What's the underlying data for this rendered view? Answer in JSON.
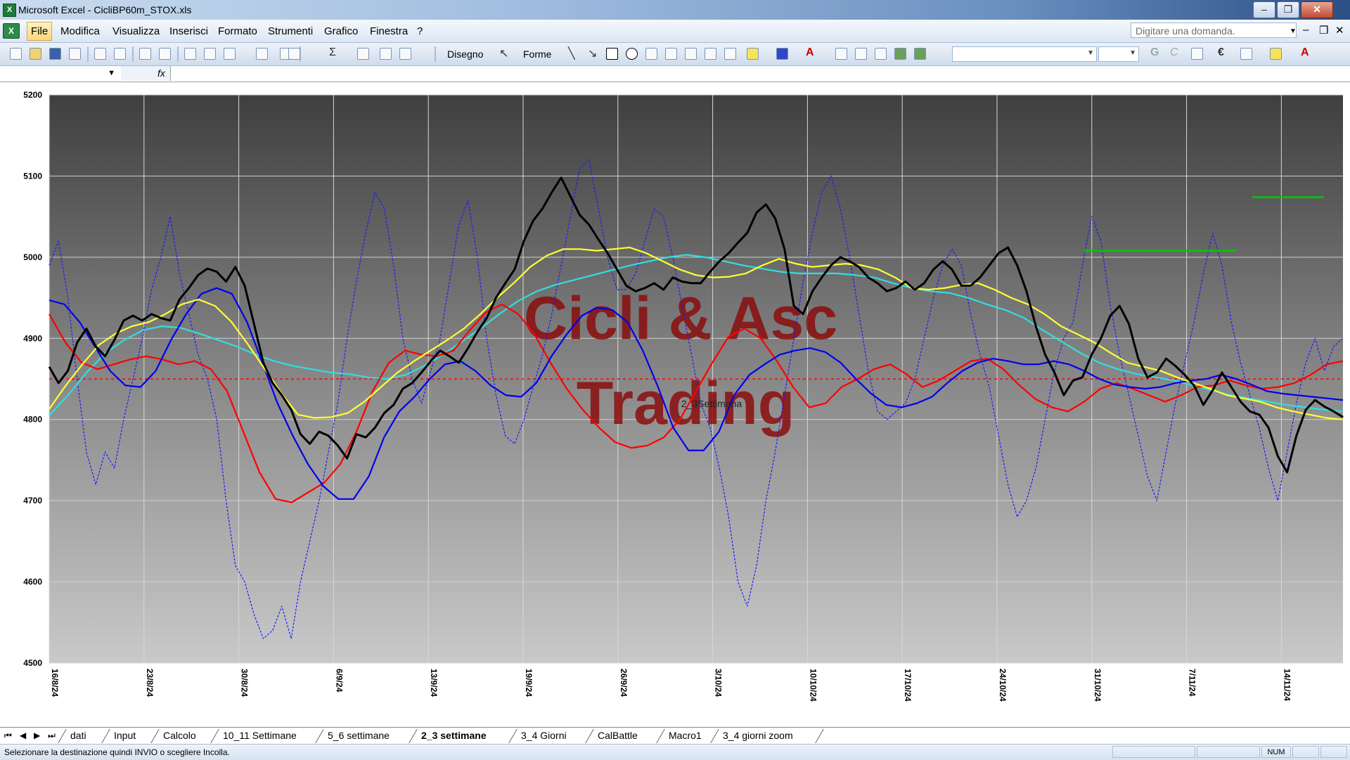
{
  "window": {
    "title": "Microsoft Excel - CicliBP60m_STOX.xls",
    "app_icon": "excel-icon"
  },
  "menu": {
    "items": [
      "File",
      "Modifica",
      "Visualizza",
      "Inserisci",
      "Formato",
      "Strumenti",
      "Grafico",
      "Finestra",
      "?"
    ],
    "active": "File",
    "help_placeholder": "Digitare una domanda."
  },
  "toolbar": {
    "draw_label": "Disegno",
    "shapes_label": "Forme"
  },
  "sheets": {
    "tabs": [
      "dati",
      "Input",
      "Calcolo",
      "10_11 Settimane",
      "5_6 settimane",
      "2_3 settimane",
      "3_4 Giorni",
      "CalBattle",
      "Macro1",
      "3_4 giorni zoom"
    ],
    "active": "2_3 settimane"
  },
  "status": {
    "message": "Selezionare la destinazione quindi INVIO o scegliere Incolla.",
    "num": "NUM"
  },
  "chart_data": {
    "type": "line",
    "title": "",
    "watermark_line1": "Cicli & Asc",
    "watermark_line2": "Trading",
    "series_label": "2_3Settimana",
    "ylim": [
      4500,
      5200
    ],
    "yticks": [
      "5200",
      "5100",
      "5000",
      "4900",
      "4800",
      "4700",
      "4600",
      "4500"
    ],
    "xticks": [
      "16/8/24",
      "23/8/24",
      "30/8/24",
      "6/9/24",
      "13/9/24",
      "19/9/24",
      "26/9/24",
      "3/10/24",
      "10/10/24",
      "17/10/24",
      "24/10/24",
      "31/10/24",
      "7/11/24",
      "14/11/24"
    ],
    "reference_level": 4850,
    "segments": [
      {
        "color": "#00cc00",
        "x_from": 0.8,
        "x_to": 0.917,
        "y": 5008
      },
      {
        "color": "#00cc00",
        "x_from": 0.93,
        "x_to": 0.985,
        "y": 5074
      }
    ],
    "colors": {
      "price": "#000000",
      "blue": "#0000ee",
      "red": "#ff0000",
      "yellow": "#ffff33",
      "cyan": "#33dddd",
      "osc": "#1a1aff",
      "refline": "#ff0000"
    },
    "series": [
      {
        "key": "price",
        "values": [
          4865,
          4845,
          4860,
          4895,
          4912,
          4890,
          4878,
          4898,
          4922,
          4928,
          4922,
          4930,
          4925,
          4922,
          4948,
          4962,
          4978,
          4986,
          4982,
          4970,
          4988,
          4965,
          4918,
          4870,
          4845,
          4830,
          4812,
          4782,
          4770,
          4785,
          4780,
          4768,
          4752,
          4782,
          4778,
          4790,
          4808,
          4818,
          4838,
          4845,
          4858,
          4872,
          4885,
          4878,
          4870,
          4888,
          4908,
          4925,
          4950,
          4968,
          4985,
          5020,
          5045,
          5060,
          5080,
          5098,
          5075,
          5052,
          5040,
          5022,
          5005,
          4985,
          4965,
          4958,
          4962,
          4968,
          4960,
          4975,
          4970,
          4968,
          4968,
          4982,
          4995,
          5005,
          5018,
          5030,
          5055,
          5065,
          5048,
          5010,
          4940,
          4930,
          4958,
          4975,
          4990,
          5000,
          4995,
          4988,
          4975,
          4968,
          4958,
          4962,
          4970,
          4960,
          4968,
          4985,
          4995,
          4985,
          4965,
          4965,
          4975,
          4990,
          5005,
          5012,
          4990,
          4958,
          4915,
          4880,
          4858,
          4830,
          4848,
          4852,
          4880,
          4900,
          4928,
          4940,
          4918,
          4875,
          4852,
          4858,
          4875,
          4866,
          4855,
          4842,
          4818,
          4836,
          4858,
          4840,
          4822,
          4810,
          4806,
          4790,
          4755,
          4735,
          4780,
          4812,
          4824,
          4816,
          4810,
          4803
        ]
      },
      {
        "key": "blue",
        "values": [
          4947,
          4942,
          4920,
          4890,
          4860,
          4842,
          4840,
          4860,
          4898,
          4930,
          4955,
          4962,
          4955,
          4920,
          4870,
          4820,
          4780,
          4745,
          4718,
          4702,
          4702,
          4730,
          4778,
          4810,
          4828,
          4850,
          4868,
          4872,
          4860,
          4842,
          4830,
          4828,
          4845,
          4878,
          4905,
          4928,
          4938,
          4935,
          4920,
          4885,
          4840,
          4790,
          4762,
          4762,
          4785,
          4830,
          4855,
          4868,
          4880,
          4885,
          4888,
          4883,
          4870,
          4850,
          4832,
          4818,
          4815,
          4820,
          4828,
          4845,
          4860,
          4870,
          4875,
          4872,
          4868,
          4868,
          4872,
          4868,
          4860,
          4850,
          4843,
          4840,
          4838,
          4840,
          4845,
          4848,
          4850,
          4855,
          4850,
          4843,
          4835,
          4832,
          4830,
          4828,
          4826,
          4824
        ]
      },
      {
        "key": "red",
        "values": [
          4930,
          4895,
          4870,
          4862,
          4868,
          4874,
          4878,
          4874,
          4868,
          4872,
          4862,
          4835,
          4785,
          4735,
          4702,
          4698,
          4710,
          4722,
          4745,
          4785,
          4835,
          4870,
          4885,
          4880,
          4878,
          4885,
          4910,
          4932,
          4942,
          4930,
          4905,
          4870,
          4838,
          4812,
          4790,
          4772,
          4765,
          4768,
          4778,
          4800,
          4835,
          4870,
          4902,
          4912,
          4900,
          4872,
          4840,
          4815,
          4820,
          4840,
          4850,
          4862,
          4868,
          4856,
          4840,
          4848,
          4860,
          4872,
          4875,
          4862,
          4842,
          4825,
          4815,
          4810,
          4822,
          4838,
          4845,
          4838,
          4830,
          4822,
          4830,
          4840,
          4842,
          4848,
          4842,
          4838,
          4840,
          4845,
          4855,
          4868,
          4872
        ]
      },
      {
        "key": "yellow",
        "values": [
          4813,
          4842,
          4868,
          4892,
          4906,
          4915,
          4920,
          4930,
          4942,
          4948,
          4940,
          4920,
          4892,
          4862,
          4832,
          4806,
          4802,
          4803,
          4808,
          4822,
          4840,
          4858,
          4872,
          4885,
          4898,
          4912,
          4930,
          4950,
          4968,
          4988,
          5002,
          5010,
          5010,
          5008,
          5010,
          5012,
          5005,
          4995,
          4985,
          4978,
          4975,
          4976,
          4980,
          4990,
          4998,
          4992,
          4988,
          4990,
          4992,
          4990,
          4985,
          4975,
          4962,
          4960,
          4962,
          4966,
          4968,
          4960,
          4950,
          4942,
          4930,
          4915,
          4905,
          4895,
          4882,
          4870,
          4865,
          4860,
          4852,
          4845,
          4838,
          4830,
          4826,
          4822,
          4815,
          4810,
          4806,
          4802,
          4800
        ]
      },
      {
        "key": "cyan",
        "values": [
          4805,
          4830,
          4858,
          4882,
          4898,
          4910,
          4915,
          4913,
          4906,
          4898,
          4890,
          4880,
          4872,
          4866,
          4862,
          4858,
          4856,
          4852,
          4850,
          4855,
          4866,
          4880,
          4896,
          4912,
          4930,
          4946,
          4958,
          4966,
          4972,
          4978,
          4984,
          4990,
          4995,
          5000,
          5003,
          5000,
          4995,
          4990,
          4986,
          4982,
          4980,
          4980,
          4980,
          4978,
          4975,
          4968,
          4962,
          4958,
          4956,
          4950,
          4942,
          4935,
          4925,
          4910,
          4896,
          4882,
          4870,
          4862,
          4856,
          4852,
          4848,
          4842,
          4836,
          4830,
          4826,
          4822,
          4818,
          4815,
          4812,
          4810
        ]
      },
      {
        "key": "osc",
        "values": [
          4990,
          5020,
          4950,
          4850,
          4760,
          4720,
          4760,
          4740,
          4800,
          4850,
          4900,
          4960,
          5000,
          5050,
          4980,
          4930,
          4880,
          4850,
          4800,
          4700,
          4620,
          4600,
          4560,
          4530,
          4540,
          4570,
          4530,
          4600,
          4650,
          4700,
          4760,
          4820,
          4900,
          4970,
          5030,
          5080,
          5060,
          4990,
          4900,
          4850,
          4820,
          4860,
          4900,
          4970,
          5040,
          5070,
          5000,
          4900,
          4830,
          4780,
          4770,
          4800,
          4840,
          4880,
          4930,
          4990,
          5050,
          5110,
          5120,
          5060,
          5000,
          4960,
          4960,
          4980,
          5020,
          5060,
          5050,
          5000,
          4940,
          4880,
          4820,
          4790,
          4740,
          4680,
          4600,
          4570,
          4620,
          4700,
          4760,
          4830,
          4900,
          4970,
          5030,
          5080,
          5100,
          5060,
          5000,
          4930,
          4860,
          4810,
          4800,
          4810,
          4820,
          4850,
          4900,
          4950,
          4990,
          5010,
          4990,
          4930,
          4880,
          4840,
          4780,
          4720,
          4680,
          4700,
          4740,
          4800,
          4860,
          4900,
          4920,
          4990,
          5050,
          5020,
          4940,
          4880,
          4830,
          4780,
          4730,
          4700,
          4760,
          4820,
          4870,
          4920,
          4980,
          5030,
          4990,
          4920,
          4870,
          4830,
          4790,
          4740,
          4700,
          4760,
          4820,
          4870,
          4900,
          4860,
          4890,
          4900
        ]
      }
    ]
  }
}
